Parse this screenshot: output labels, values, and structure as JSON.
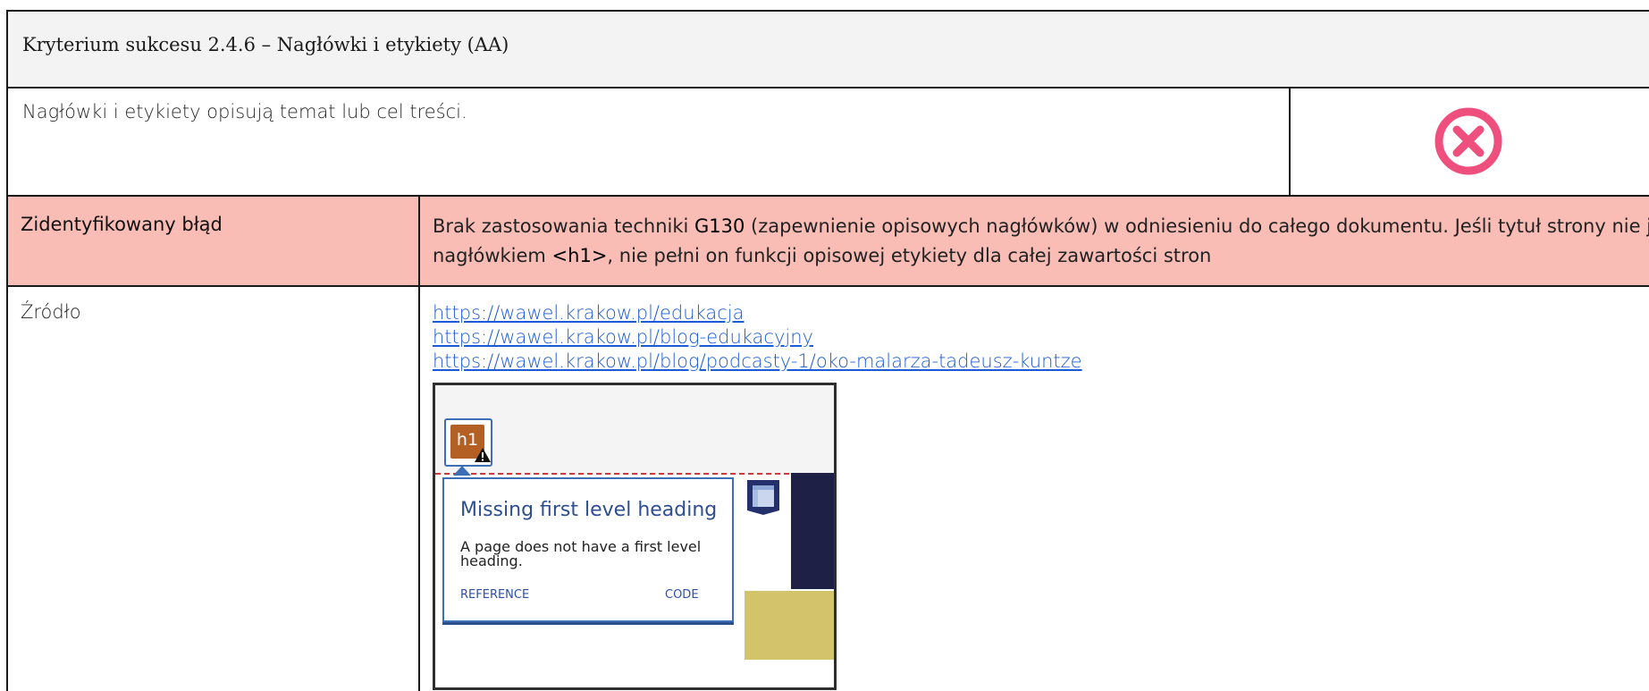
{
  "header": {
    "title": "Kryterium sukcesu 2.4.6 – Nagłówki i etykiety  (AA)"
  },
  "criterion": {
    "description": "Nagłówki i etykiety opisują temat lub cel treści.",
    "status_icon": "fail-x-circle-icon",
    "status_color": "#ee4f7d"
  },
  "error": {
    "label": "Zidentyfikowany błąd",
    "text_before": "Brak zastosowania techniki ",
    "technique": "G130",
    "text_middle": " (zapewnienie opisowych nagłówków) w odniesieniu do całego dokumentu. Jeśli tytuł strony nie jest nagłówkiem ",
    "tag": "<h1>",
    "text_after": ", nie pełni on funkcji opisowej etykiety dla całej zawartości stron",
    "row_color": "#f9bdb6"
  },
  "source": {
    "label": "Źródło",
    "links": [
      "https://wawel.krakow.pl/edukacja",
      "https://wawel.krakow.pl/blog-edukacyjny",
      "https://wawel.krakow.pl/blog/podcasty-1/oko-malarza-tadeusz-kuntze"
    ]
  },
  "screenshot": {
    "badge": "h1",
    "popover_title": "Missing first level heading",
    "popover_body": "A page does not have a first level heading.",
    "reference_label": "REFERENCE",
    "code_label": "CODE"
  }
}
